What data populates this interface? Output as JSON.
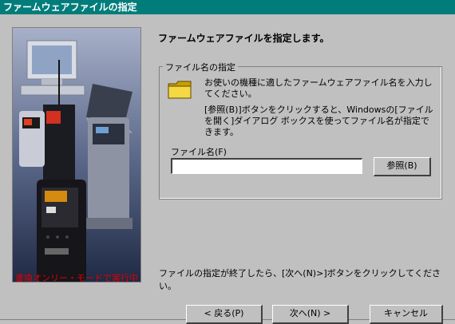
{
  "window": {
    "title": "ファームウェアファイルの指定"
  },
  "left_panel": {
    "status": "書換オンリー・モードで実行中"
  },
  "main": {
    "heading": "ファームウェアファイルを指定します。",
    "group": {
      "legend": "ファイル名の指定",
      "description1": "お使いの機種に適したファームウェアファイル名を入力してください。",
      "description2": "[参照(B)]ボタンをクリックすると、Windowsの[ファイルを開く]ダイアログ ボックスを使ってファイル名が指定できます。",
      "file_label": "ファイル名(F)",
      "file_value": "",
      "browse_label": "参照(B)"
    },
    "note": "ファイルの指定が終了したら、[次へ(N)>]ボタンをクリックしてください。"
  },
  "buttons": {
    "back": "< 戻る(P)",
    "next": "次へ(N) >",
    "cancel": "キャンセル"
  }
}
